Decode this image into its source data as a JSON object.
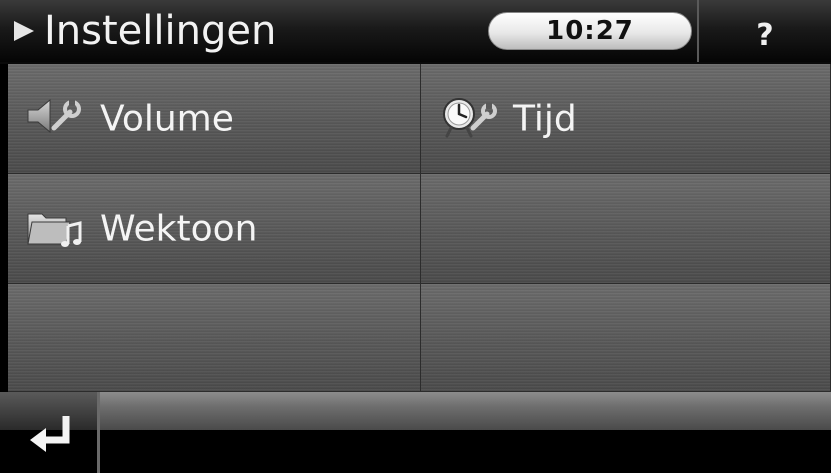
{
  "header": {
    "title": "Instellingen",
    "clock": "10:27",
    "help_label": "?"
  },
  "menu": {
    "items": [
      {
        "label": "Volume",
        "icon": "volume-settings-icon"
      },
      {
        "label": "Tijd",
        "icon": "clock-settings-icon"
      },
      {
        "label": "Wektoon",
        "icon": "alarm-tone-folder-icon"
      }
    ]
  },
  "footer": {
    "back_icon": "return-arrow-icon"
  },
  "colors": {
    "header_bg": "#1a1a1a",
    "tile_bg": "#5a5a5a",
    "text": "#f4f4f4",
    "clock_bg": "#e8e8e8"
  }
}
